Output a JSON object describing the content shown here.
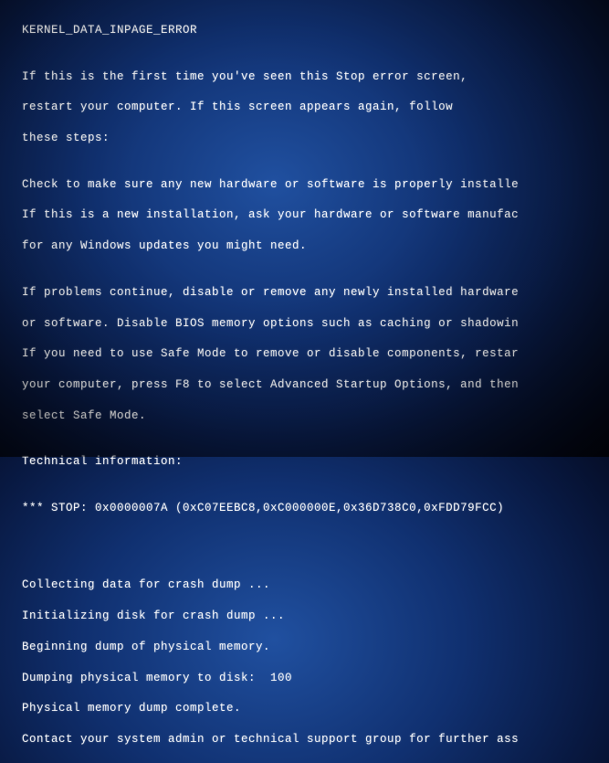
{
  "error_name": "KERNEL_DATA_INPAGE_ERROR",
  "intro1": "If this is the first time you've seen this Stop error screen,",
  "intro2": "restart your computer. If this screen appears again, follow",
  "intro3": "these steps:",
  "check1": "Check to make sure any new hardware or software is properly installe",
  "check2": "If this is a new installation, ask your hardware or software manufac",
  "check3": "for any Windows updates you might need.",
  "prob1": "If problems continue, disable or remove any newly installed hardware",
  "prob2": "or software. Disable BIOS memory options such as caching or shadowin",
  "prob3": "If you need to use Safe Mode to remove or disable components, restar",
  "prob4": "your computer, press F8 to select Advanced Startup Options, and then",
  "prob5": "select Safe Mode.",
  "tech_header": "Technical information:",
  "stop_line": "*** STOP: 0x0000007A (0xC07EEBC8,0xC000000E,0x36D738C0,0xFDD79FCC)",
  "dump1": "Collecting data for crash dump ...",
  "dump2": "Initializing disk for crash dump ...",
  "dump3": "Beginning dump of physical memory.",
  "dump4": "Dumping physical memory to disk:  100",
  "dump5": "Physical memory dump complete.",
  "dump6": "Contact your system admin or technical support group for further ass"
}
